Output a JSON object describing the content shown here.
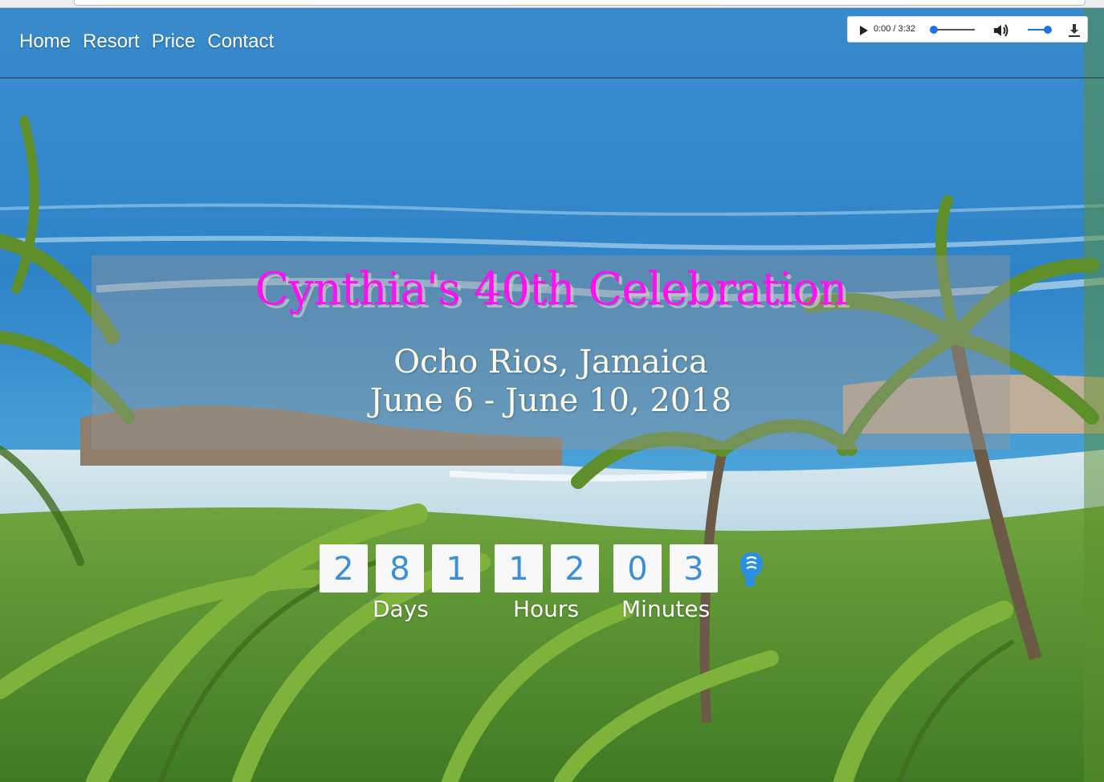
{
  "nav": {
    "items": [
      "Home",
      "Resort",
      "Price",
      "Contact"
    ]
  },
  "audio": {
    "time": "0:00 / 3:32",
    "progress": 0.0,
    "volume": 1.0,
    "play_icon": "play-icon",
    "volume_icon": "volume-icon",
    "download_icon": "download-icon",
    "accent": "#1a73e8"
  },
  "hero": {
    "title": "Cynthia's 40th Celebration",
    "place": "Ocho Rios, Jamaica",
    "dates": "June 6 - June 10, 2018",
    "title_color": "#ff10f0",
    "text_color": "#fffbe6"
  },
  "countdown": {
    "days_digits": [
      "2",
      "8",
      "1"
    ],
    "hours_digits": [
      "1",
      "2"
    ],
    "minutes_digits": [
      "0",
      "3"
    ],
    "labels": {
      "days": "Days",
      "hours": "Hours",
      "minutes": "Minutes"
    },
    "digit_color": "#3a8fd8"
  }
}
